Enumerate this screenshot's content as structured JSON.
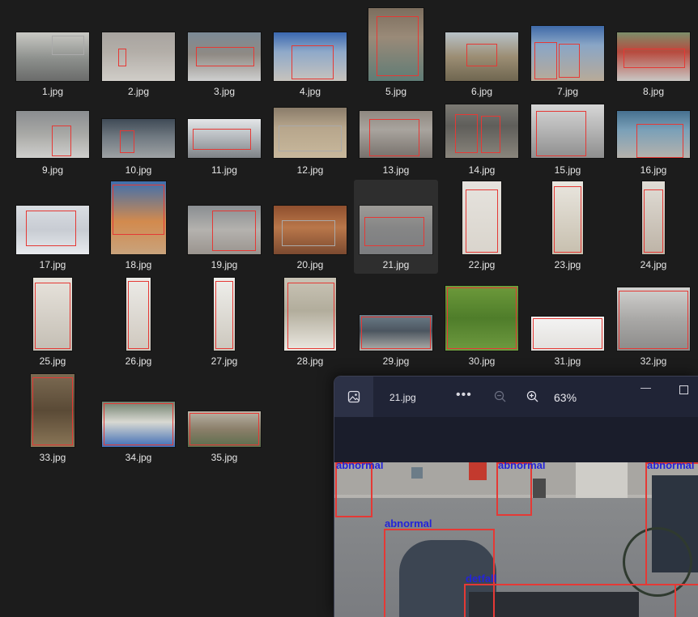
{
  "files": [
    {
      "name": "1.jpg"
    },
    {
      "name": "2.jpg"
    },
    {
      "name": "3.jpg"
    },
    {
      "name": "4.jpg"
    },
    {
      "name": "5.jpg"
    },
    {
      "name": "6.jpg"
    },
    {
      "name": "7.jpg"
    },
    {
      "name": "8.jpg"
    },
    {
      "name": "9.jpg"
    },
    {
      "name": "10.jpg"
    },
    {
      "name": "11.jpg"
    },
    {
      "name": "12.jpg"
    },
    {
      "name": "13.jpg"
    },
    {
      "name": "14.jpg"
    },
    {
      "name": "15.jpg"
    },
    {
      "name": "16.jpg"
    },
    {
      "name": "17.jpg"
    },
    {
      "name": "18.jpg"
    },
    {
      "name": "19.jpg"
    },
    {
      "name": "20.jpg"
    },
    {
      "name": "21.jpg"
    },
    {
      "name": "22.jpg"
    },
    {
      "name": "23.jpg"
    },
    {
      "name": "24.jpg"
    },
    {
      "name": "25.jpg"
    },
    {
      "name": "26.jpg"
    },
    {
      "name": "27.jpg"
    },
    {
      "name": "28.jpg"
    },
    {
      "name": "29.jpg"
    },
    {
      "name": "30.jpg"
    },
    {
      "name": "31.jpg"
    },
    {
      "name": "32.jpg"
    },
    {
      "name": "33.jpg"
    },
    {
      "name": "34.jpg"
    },
    {
      "name": "35.jpg"
    }
  ],
  "selected_file": "21.jpg",
  "viewer": {
    "file_name": "21.jpg",
    "more_label": "•••",
    "zoom_level": "63%",
    "minimize_label": "—",
    "detections": [
      {
        "label": "abnormal"
      },
      {
        "label": "abnormal"
      },
      {
        "label": "abnormal"
      },
      {
        "label": "abnormal"
      },
      {
        "label": "detfall"
      }
    ]
  },
  "colors": {
    "background": "#1c1c1c",
    "viewer_bg": "#1a1d2b",
    "box_red": "#e53935",
    "label_blue": "#2424d8"
  }
}
